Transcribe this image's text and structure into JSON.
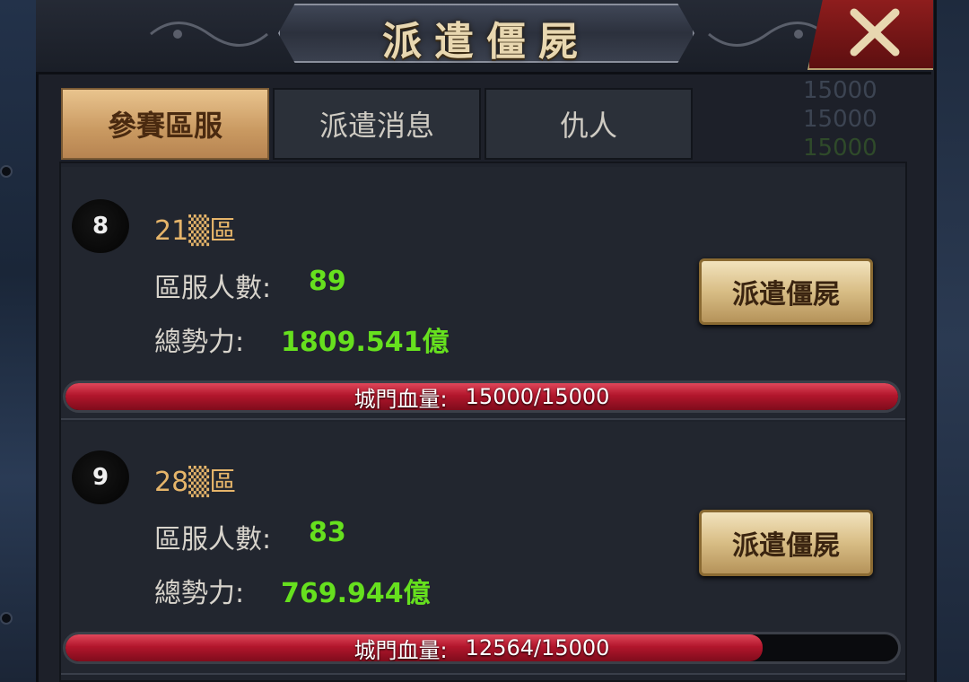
{
  "header": {
    "title": "派遣僵屍",
    "close_icon": "close-x-icon"
  },
  "tabs": [
    {
      "label": "參賽區服",
      "active": true
    },
    {
      "label": "派遣消息",
      "active": false
    },
    {
      "label": "仇人",
      "active": false
    }
  ],
  "background_values": [
    "15000",
    "15000",
    "15000"
  ],
  "labels": {
    "members": "區服人數:",
    "power": "總勢力:",
    "gate_hp": "城門血量:"
  },
  "servers": [
    {
      "rank": "8",
      "name": "21▒區",
      "members": "89",
      "power": "1809.541億",
      "hp_text": "15000/15000",
      "hp_fraction": 1.0,
      "button_label": "派遣僵屍"
    },
    {
      "rank": "9",
      "name": "28▒區",
      "members": "83",
      "power": "769.944億",
      "hp_text": "12564/15000",
      "hp_fraction": 0.8376,
      "button_label": "派遣僵屍"
    }
  ],
  "colors": {
    "accent_gold": "#e6b56a",
    "value_green": "#66e01e",
    "hp_red": "#b2162c"
  }
}
